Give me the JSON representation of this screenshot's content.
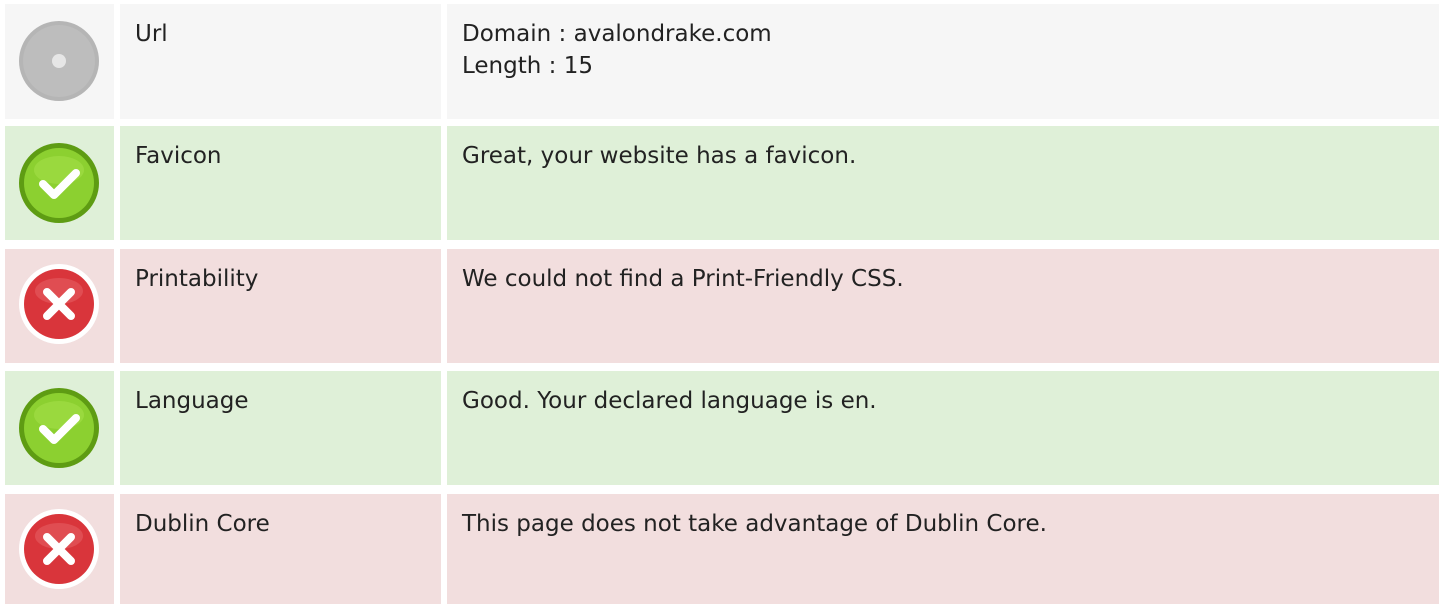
{
  "rows": [
    {
      "status": "neutral",
      "icon": "neutral-circle-icon",
      "label": "Url",
      "value_lines": [
        "Domain : avalondrake.com",
        "Length : 15"
      ]
    },
    {
      "status": "pass",
      "icon": "check-icon",
      "label": "Favicon",
      "value_lines": [
        "Great, your website has a favicon."
      ]
    },
    {
      "status": "fail",
      "icon": "error-x-icon",
      "label": "Printability",
      "value_lines": [
        "We could not find a Print-Friendly CSS."
      ]
    },
    {
      "status": "pass",
      "icon": "check-icon",
      "label": "Language",
      "value_lines": [
        "Good. Your declared language is en."
      ]
    },
    {
      "status": "fail",
      "icon": "error-x-icon",
      "label": "Dublin Core",
      "value_lines": [
        "This page does not take advantage of Dublin Core."
      ]
    }
  ],
  "colors": {
    "neutral_bg": "#f6f6f6",
    "pass_bg": "#dff0d8",
    "fail_bg": "#f2dede",
    "pass_icon": "#7cc225",
    "fail_icon": "#d9353b",
    "neutral_icon": "#b5b5b5"
  }
}
